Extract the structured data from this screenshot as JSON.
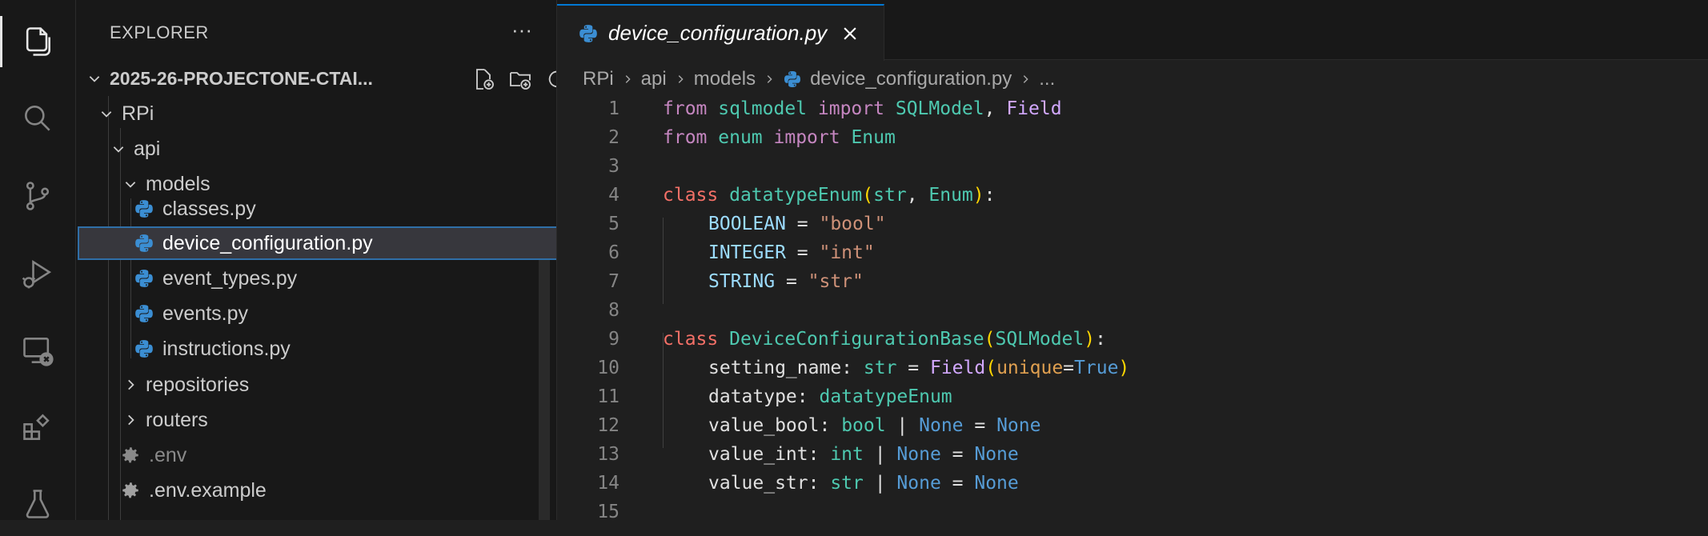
{
  "activity_bar": {
    "items": [
      {
        "icon": "explorer-icon",
        "active": true
      },
      {
        "icon": "search-icon",
        "active": false
      },
      {
        "icon": "source-control-icon",
        "active": false
      },
      {
        "icon": "run-debug-icon",
        "active": false
      },
      {
        "icon": "remote-explorer-icon",
        "active": false
      },
      {
        "icon": "extensions-icon",
        "active": false
      },
      {
        "icon": "testing-icon",
        "active": false
      }
    ]
  },
  "sidebar": {
    "title": "EXPLORER",
    "more": "···",
    "root_label": "2025-26-PROJECTONE-CTAI...",
    "tree": [
      {
        "label": "RPi"
      },
      {
        "label": "api"
      },
      {
        "label": "models"
      },
      {
        "label": "classes.py"
      },
      {
        "label": "device_configuration.py"
      },
      {
        "label": "event_types.py"
      },
      {
        "label": "events.py"
      },
      {
        "label": "instructions.py"
      },
      {
        "label": "repositories"
      },
      {
        "label": "routers"
      },
      {
        "label": ".env"
      },
      {
        "label": ".env.example"
      }
    ]
  },
  "editor": {
    "tab_label": "device_configuration.py",
    "breadcrumb": [
      "RPi",
      "api",
      "models",
      "device_configuration.py",
      "..."
    ],
    "line_numbers": [
      "1",
      "2",
      "3",
      "4",
      "5",
      "6",
      "7",
      "8",
      "9",
      "10",
      "11",
      "12",
      "13",
      "14",
      "15"
    ],
    "code": {
      "l1": [
        "from",
        " ",
        "sqlmodel",
        " ",
        "import",
        " ",
        "SQLModel",
        ", ",
        "Field"
      ],
      "l2": [
        "from",
        " ",
        "enum",
        " ",
        "import",
        " ",
        "Enum"
      ],
      "l4": [
        "class",
        " ",
        "datatypeEnum",
        "(",
        "str",
        ", ",
        "Enum",
        ")",
        ":"
      ],
      "l5": [
        "BOOLEAN",
        " = ",
        "\"bool\""
      ],
      "l6": [
        "INTEGER",
        " = ",
        "\"int\""
      ],
      "l7": [
        "STRING",
        " = ",
        "\"str\""
      ],
      "l9": [
        "class",
        " ",
        "DeviceConfigurationBase",
        "(",
        "SQLModel",
        ")",
        ":"
      ],
      "l10": [
        "setting_name",
        ": ",
        "str",
        " = ",
        "Field",
        "(",
        "unique",
        "=",
        "True",
        ")"
      ],
      "l11": [
        "datatype",
        ": ",
        "datatypeEnum"
      ],
      "l12": [
        "value_bool",
        ": ",
        "bool",
        " | ",
        "None",
        " = ",
        "None"
      ],
      "l13": [
        "value_int",
        ": ",
        "int",
        " | ",
        "None",
        " = ",
        "None"
      ],
      "l14": [
        "value_str",
        ": ",
        "str",
        " | ",
        "None",
        " = ",
        "None"
      ]
    }
  },
  "colors": {
    "accent": "#0078d4",
    "python_icon": "#3b8ed3"
  }
}
